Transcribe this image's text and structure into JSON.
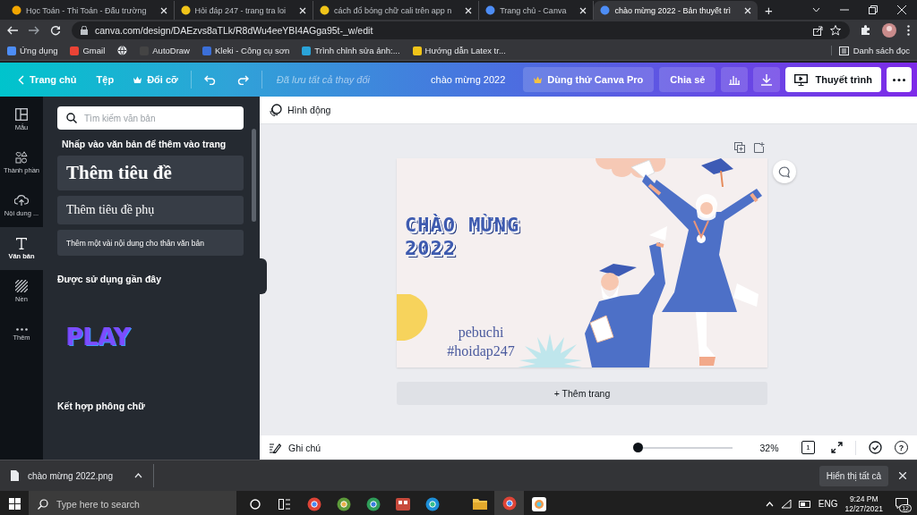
{
  "browser": {
    "tabs": [
      {
        "title": "Học Toán - Thi Toán - Đấu trường",
        "selected": false
      },
      {
        "title": "Hỏi đáp 247 - trang tra loi",
        "selected": false
      },
      {
        "title": "cách đổ bóng chữ cali trên app n",
        "selected": false
      },
      {
        "title": "Trang chủ - Canva",
        "selected": false
      },
      {
        "title": "chào mừng 2022 - Bản thuyết trì",
        "selected": true
      }
    ],
    "new_tab": "+",
    "url": "canva.com/design/DAEzvs8aTLk/R8dWu4eeYBI4AGga95t-_w/edit",
    "bookmarks": [
      "Ứng dụng",
      "Gmail",
      "AutoDraw",
      "Kleki - Công cụ sơn",
      "Trình chỉnh sửa ảnh:...",
      "Hướng dẫn Latex tr..."
    ],
    "reading_list": "Danh sách đọc"
  },
  "toolbar": {
    "home": "Trang chủ",
    "file": "Tệp",
    "resize": "Đổi cỡ",
    "save_status": "Đã lưu tất cả thay đổi",
    "design_title": "chào mừng 2022",
    "try_pro": "Dùng thử Canva Pro",
    "share": "Chia sẻ",
    "present": "Thuyết trình"
  },
  "sidebar": {
    "items": [
      {
        "label": "Mẫu",
        "selected": false
      },
      {
        "label": "Thành phần",
        "selected": false
      },
      {
        "label": "Nội dung ...",
        "selected": false
      },
      {
        "label": "Văn bản",
        "selected": true
      },
      {
        "label": "Nền",
        "selected": false
      },
      {
        "label": "Thêm",
        "selected": false
      }
    ]
  },
  "text_panel": {
    "search": {
      "placeholder": "Tìm kiếm văn bản"
    },
    "prompt": "Nhấp vào văn bản để thêm vào trang",
    "text_styles": [
      {
        "kind": "heading",
        "text": "Thêm tiêu đề"
      },
      {
        "kind": "subheading",
        "text": "Thêm tiêu đề phụ"
      },
      {
        "kind": "body",
        "text": "Thêm một vài nội dung cho thân văn bản"
      }
    ],
    "recent_heading": "Được sử dụng gần đây",
    "recent_sample": "PLAY",
    "combos_heading": "Kết hợp phông chữ"
  },
  "editor": {
    "animate": "Hình động",
    "design": {
      "title": "CHÀO MỪNG 2022",
      "credit_lines": [
        "pebuchi",
        "#hoidap247"
      ]
    },
    "add_page": "+ Thêm trang",
    "notes": "Ghi chú",
    "zoom": {
      "level": 0,
      "reading": "32%"
    },
    "page_count": "1",
    "help": "?"
  },
  "download_bar": {
    "file": "chào mừng 2022.png",
    "show_all": "Hiển thị tất cả"
  },
  "taskbar": {
    "search": {
      "placeholder": "Type here to search"
    },
    "language": "ENG",
    "time": "9:24 PM",
    "date": "12/27/2021",
    "notifications": "12"
  }
}
